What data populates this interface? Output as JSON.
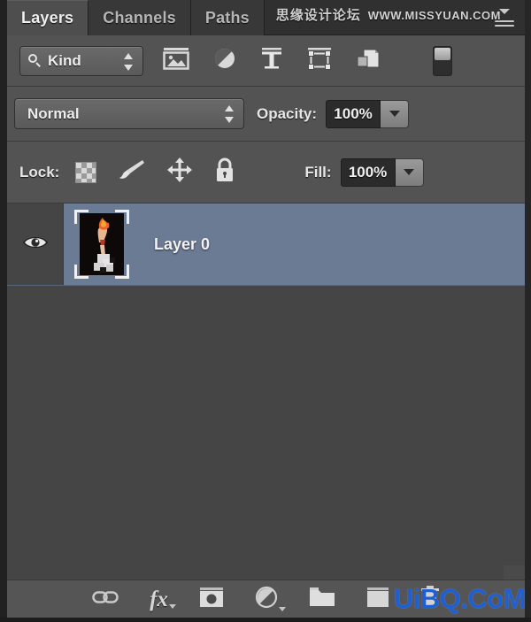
{
  "panel": {
    "title": "Layers",
    "menu_icon": "hamburger-menu-icon"
  },
  "tabs": [
    {
      "label": "Layers",
      "active": true
    },
    {
      "label": "Channels",
      "active": false
    },
    {
      "label": "Paths",
      "active": false
    }
  ],
  "filter_bar": {
    "kind_label": "Kind",
    "search_icon": "magnifier-icon",
    "stepper_icon": "up-down-stepper-icon",
    "icons": [
      {
        "name": "filter-pixel-layers-icon",
        "title": "Filter for pixel layers"
      },
      {
        "name": "filter-adjustment-layers-icon",
        "title": "Filter for adjustment layers"
      },
      {
        "name": "filter-type-layers-icon",
        "title": "Filter for type layers"
      },
      {
        "name": "filter-shape-layers-icon",
        "title": "Filter for shape layers"
      },
      {
        "name": "filter-smart-object-layers-icon",
        "title": "Filter for smart objects"
      }
    ],
    "toggle_name": "filter-enable-toggle"
  },
  "blend_bar": {
    "mode_value": "Normal",
    "opacity_label": "Opacity:",
    "opacity_value": "100%",
    "opacity_arrow_icon": "chevron-down-icon"
  },
  "lock_bar": {
    "lock_label": "Lock:",
    "icons": [
      {
        "name": "lock-transparent-pixels-icon"
      },
      {
        "name": "lock-image-pixels-brush-icon"
      },
      {
        "name": "lock-position-move-icon"
      },
      {
        "name": "lock-all-padlock-icon"
      }
    ],
    "fill_label": "Fill:",
    "fill_value": "100%",
    "fill_arrow_icon": "chevron-down-icon"
  },
  "layers": [
    {
      "name": "Layer 0",
      "visible": true,
      "selected": true,
      "visibility_icon": "eye-icon",
      "thumbnail": "layer-thumbnail"
    }
  ],
  "bottom_bar": {
    "icons": [
      {
        "name": "link-layers-icon"
      },
      {
        "name": "layer-style-fx-icon",
        "label": "fx"
      },
      {
        "name": "add-layer-mask-icon"
      },
      {
        "name": "new-adjustment-layer-icon"
      },
      {
        "name": "new-group-folder-icon"
      },
      {
        "name": "new-layer-icon"
      },
      {
        "name": "delete-layer-trash-icon"
      }
    ]
  },
  "watermarks": {
    "top_cn": "思缘设计论坛",
    "top_url": "WWW.MISSYUAN.COM",
    "bottom": "UiBQ.CoM"
  },
  "colors": {
    "panel_bg": "#535353",
    "tab_bar_bg": "#303030",
    "tab_active_bg": "#4e4e4e",
    "list_bg": "#454545",
    "selected_row": "#6c7b94",
    "text": "#ededed",
    "watermark_blue": "#1f5fd0"
  }
}
